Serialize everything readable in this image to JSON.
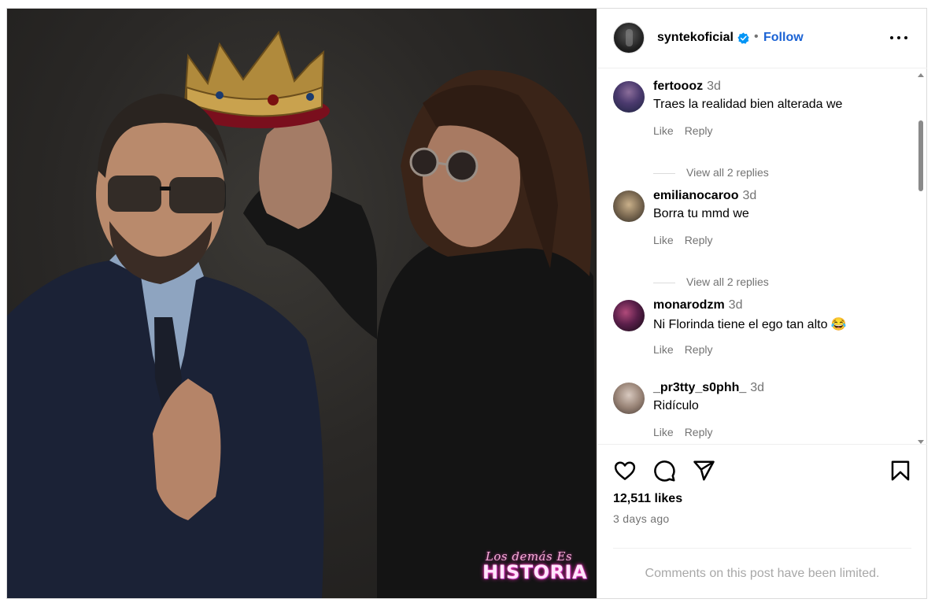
{
  "post": {
    "watermark_script": "Los demás Es",
    "watermark_main": "HISTORIA"
  },
  "header": {
    "username": "syntekoficial",
    "separator": "•",
    "follow_label": "Follow"
  },
  "comments": [
    {
      "user": "fertoooz",
      "time": "3d",
      "text": "Traes la realidad bien alterada we",
      "like": "Like",
      "reply": "Reply",
      "view_replies": "View all 2 replies"
    },
    {
      "user": "emilianocaroo",
      "time": "3d",
      "text": "Borra tu mmd we",
      "like": "Like",
      "reply": "Reply",
      "view_replies": "View all 2 replies"
    },
    {
      "user": "monarodzm",
      "time": "3d",
      "text": "Ni Florinda tiene el ego tan alto 😂",
      "like": "Like",
      "reply": "Reply"
    },
    {
      "user": "_pr3tty_s0phh_",
      "time": "3d",
      "text": "Ridículo",
      "like": "Like",
      "reply": "Reply"
    }
  ],
  "footer": {
    "likes": "12,511 likes",
    "date": "3 days ago",
    "comments_limited": "Comments on this post have been limited."
  },
  "icons": {
    "like": "heart-icon",
    "comment": "speech-bubble-icon",
    "share": "paper-plane-icon",
    "save": "bookmark-icon",
    "more": "three-dots-icon",
    "verified": "verified-badge-icon"
  },
  "colors": {
    "follow": "#1a62d4",
    "verified": "#0095f6",
    "muted": "#737373",
    "border": "#dbdbdb"
  }
}
